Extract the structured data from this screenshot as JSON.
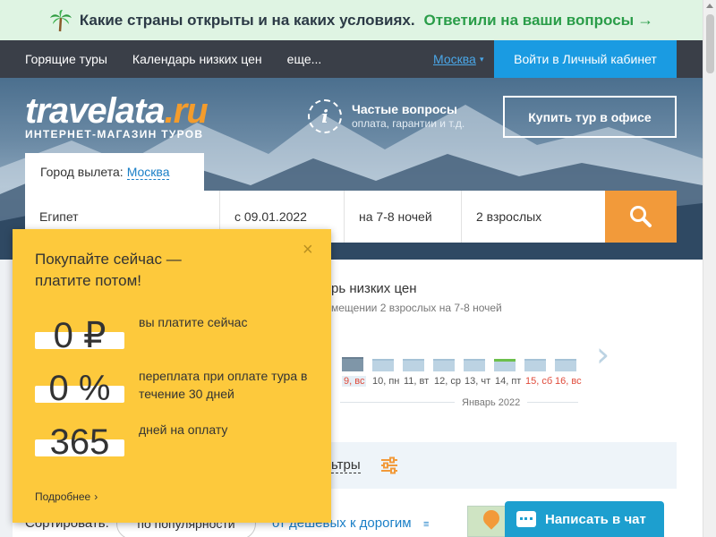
{
  "promo_banner": {
    "text": "Какие страны открыты и на каких условиях.",
    "link": "Ответили на ваши вопросы",
    "arrow": "→"
  },
  "nav": {
    "items": [
      "Горящие туры",
      "Календарь низких цен",
      "еще..."
    ],
    "city": "Москва",
    "city_caret": "▾",
    "login": "Войти в Личный кабинет"
  },
  "hero": {
    "logo_main": "travelata",
    "logo_tld": ".ru",
    "tagline": "ИНТЕРНЕТ-МАГАЗИН ТУРОВ",
    "faq_icon": "i",
    "faq_title": "Частые вопросы",
    "faq_sub": "оплата, гарантии и т.д.",
    "office_button": "Купить тур в офисе"
  },
  "search": {
    "depart_label": "Город вылета:",
    "depart_city": "Москва",
    "country": "Египет",
    "date": "с 09.01.2022",
    "nights": "на 7-8 ночей",
    "guests": "2 взрослых",
    "search_icon": "search-icon"
  },
  "calendar": {
    "title": "рь низких цен",
    "subtitle": "мещении 2 взрослых на 7-8 ночей",
    "next": "›",
    "days": [
      {
        "label": "9, вс",
        "weekend": true,
        "selected": true
      },
      {
        "label": "10, пн",
        "weekend": false,
        "selected": false
      },
      {
        "label": "11, вт",
        "weekend": false,
        "selected": false
      },
      {
        "label": "12, ср",
        "weekend": false,
        "selected": false
      },
      {
        "label": "13, чт",
        "weekend": false,
        "selected": false
      },
      {
        "label": "14, пт",
        "weekend": false,
        "selected": false
      },
      {
        "label": "15, сб",
        "weekend": true,
        "selected": false
      },
      {
        "label": "16, вс",
        "weekend": true,
        "selected": false
      }
    ],
    "month": "Январь 2022"
  },
  "filters": {
    "label": "ьтры"
  },
  "sort": {
    "label": "Сортировать:",
    "popular": "по популярности",
    "cheap": "от дешевых к дорогим",
    "cheap_icon": "≡"
  },
  "chat": {
    "label": "Написать в чат"
  },
  "popup": {
    "close": "×",
    "title": "Покупайте сейчас — платите потом!",
    "rows": [
      {
        "value": "0 ₽",
        "desc": "вы платите сейчас"
      },
      {
        "value": "0 %",
        "desc": "переплата при оплате тура в течение 30 дней"
      },
      {
        "value": "365",
        "desc": "дней на оплату"
      }
    ],
    "more": "Подробнее",
    "more_chev": "›"
  },
  "colors": {
    "accent_orange": "#f29a3a",
    "brand_blue": "#1a9be2",
    "popup_yellow": "#fdc93c",
    "banner_green": "#2a9d49"
  }
}
